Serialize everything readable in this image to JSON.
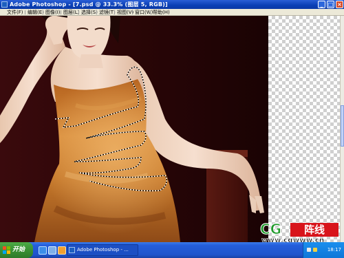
{
  "window": {
    "title": "Adobe Photoshop - [7.psd @ 33.3% (图层 5, RGB)]",
    "controls": [
      "_",
      "□",
      "×"
    ]
  },
  "menu": {
    "items": [
      "文件(F)",
      "编辑(E)",
      "图像(I)",
      "图层(L)",
      "选择(S)",
      "滤镜(T)",
      "视图(V)",
      "窗口(W)",
      "帮助(H)"
    ]
  },
  "document": {
    "zoom": "33.3%",
    "layer": "图层 5",
    "mode": "RGB",
    "selection": "marching-ants",
    "transparent_area": "checkerboard"
  },
  "taskbar": {
    "start_label": "开始",
    "task_item_label": "Adobe Photoshop - ...",
    "clock": "18:17",
    "quick_launch_icons": [
      "ie-icon",
      "desktop-icon",
      "media-icon"
    ]
  },
  "watermark": {
    "logo_text": "CG",
    "brand_cn": "阵线",
    "url": "www.cgwww.cn"
  },
  "colors": {
    "titlebar": "#0a3fb5",
    "menubar": "#ece9d8",
    "canvas_bg": "#2b0607",
    "dress": "#c9782a",
    "taskbar": "#245edb",
    "start": "#3a9135",
    "watermark_green": "#1f9a2a",
    "watermark_red": "#d8141b"
  }
}
